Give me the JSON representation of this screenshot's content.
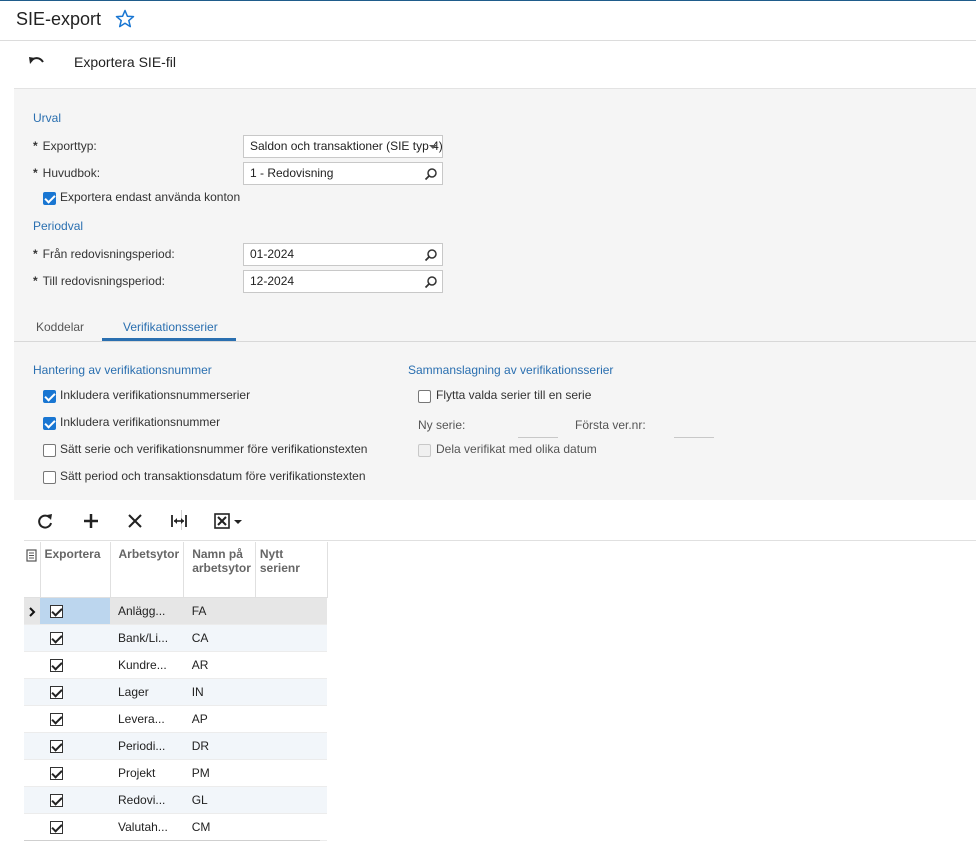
{
  "page": {
    "title": "SIE-export",
    "action_title": "Exportera SIE-fil"
  },
  "urval": {
    "heading": "Urval",
    "exporttyp_label": "Exporttyp:",
    "exporttyp_value": "Saldon och transaktioner (SIE typ 4)",
    "huvudbok_label": "Huvudbok:",
    "huvudbok_value": "1 - Redovisning",
    "only_used_label": "Exportera endast använda konton"
  },
  "periodval": {
    "heading": "Periodval",
    "from_label": "Från redovisningsperiod:",
    "from_value": "01-2024",
    "to_label": "Till redovisningsperiod:",
    "to_value": "12-2024"
  },
  "tabs": [
    {
      "label": "Koddelar"
    },
    {
      "label": "Verifikationsserier"
    }
  ],
  "hantering": {
    "heading": "Hantering av verifikationsnummer",
    "options": [
      {
        "label": "Inkludera verifikationsnummerserier",
        "checked": true
      },
      {
        "label": "Inkludera verifikationsnummer",
        "checked": true
      },
      {
        "label": "Sätt serie och verifikationsnummer före verifikationstexten",
        "checked": false
      },
      {
        "label": "Sätt period och transaktionsdatum före verifikationstexten",
        "checked": false
      }
    ]
  },
  "sammanslagning": {
    "heading": "Sammanslagning av verifikationsserier",
    "move_label": "Flytta valda serier till en serie",
    "ny_serie_label": "Ny serie:",
    "forsta_label": "Första ver.nr:",
    "split_label": "Dela verifikat med olika datum"
  },
  "grid": {
    "columns": [
      "Exportera",
      "Arbetsytor",
      "Namn på arbetsytor",
      "Nytt serienr"
    ],
    "rows": [
      {
        "export": true,
        "arbetsyta": "Anlägg...",
        "namn": "FA",
        "serienr": ""
      },
      {
        "export": true,
        "arbetsyta": "Bank/Li...",
        "namn": "CA",
        "serienr": ""
      },
      {
        "export": true,
        "arbetsyta": "Kundre...",
        "namn": "AR",
        "serienr": ""
      },
      {
        "export": true,
        "arbetsyta": "Lager",
        "namn": "IN",
        "serienr": ""
      },
      {
        "export": true,
        "arbetsyta": "Levera...",
        "namn": "AP",
        "serienr": ""
      },
      {
        "export": true,
        "arbetsyta": "Periodi...",
        "namn": "DR",
        "serienr": ""
      },
      {
        "export": true,
        "arbetsyta": "Projekt",
        "namn": "PM",
        "serienr": ""
      },
      {
        "export": true,
        "arbetsyta": "Redovi...",
        "namn": "GL",
        "serienr": ""
      },
      {
        "export": true,
        "arbetsyta": "Valutah...",
        "namn": "CM",
        "serienr": ""
      }
    ]
  },
  "colors": {
    "accent": "#2a6fb0",
    "checkbox": "#1976d2",
    "panel": "#f5f5f5"
  },
  "icons": [
    "star-icon",
    "undo-icon",
    "search-icon",
    "dropdown-caret-icon",
    "refresh-icon",
    "add-icon",
    "delete-icon",
    "fit-columns-icon",
    "excel-export-icon",
    "column-config-icon",
    "row-arrow-icon"
  ]
}
